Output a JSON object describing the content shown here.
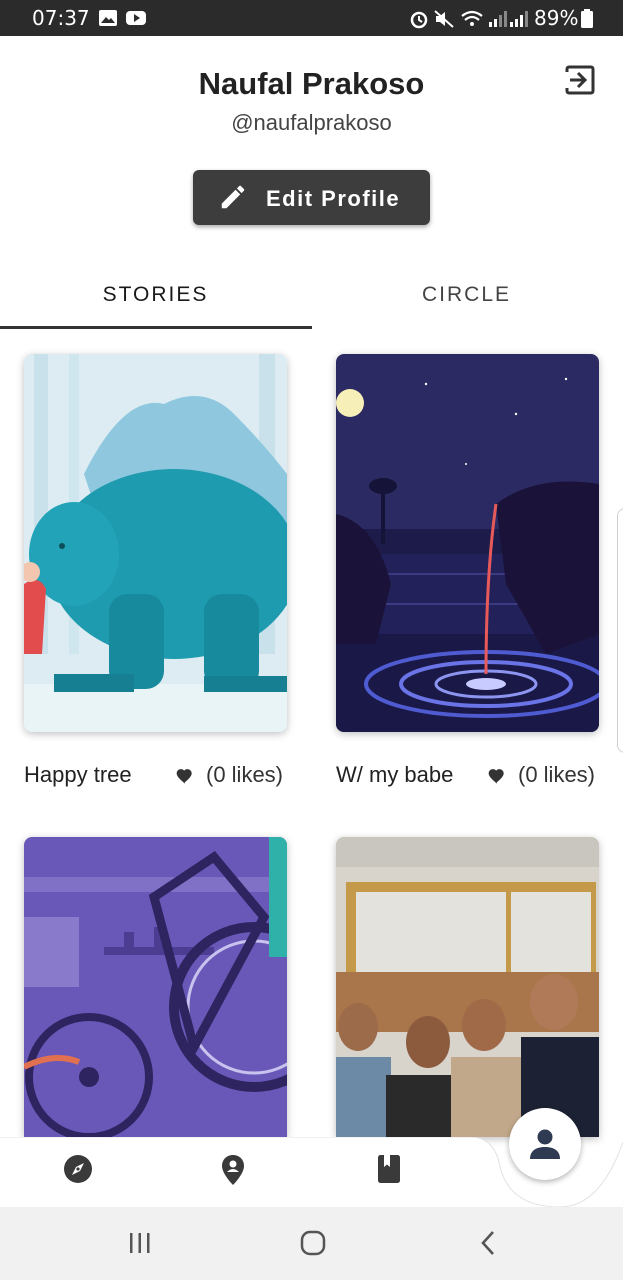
{
  "status_bar": {
    "time": "07:37",
    "battery": "89%"
  },
  "profile": {
    "name": "Naufal Prakoso",
    "handle": "@naufalprakoso",
    "edit_label": "Edit Profile"
  },
  "tabs": [
    {
      "label": "STORIES",
      "selected": true
    },
    {
      "label": "CIRCLE",
      "selected": false
    }
  ],
  "stories": [
    {
      "title": "Happy tree",
      "likes": "(0 likes)"
    },
    {
      "title": "W/ my babe",
      "likes": "(0 likes)"
    },
    {
      "title": "",
      "likes": ""
    },
    {
      "title": "",
      "likes": ""
    }
  ],
  "bottom_nav": [
    {
      "icon": "compass-icon"
    },
    {
      "icon": "location-pin-icon"
    },
    {
      "icon": "book-icon"
    },
    {
      "icon": "person-icon",
      "active": true
    }
  ],
  "colors": {
    "button_bg": "#3d3d3d",
    "status_bar": "#2b2b2b",
    "system_nav": "#f1f1f1"
  }
}
